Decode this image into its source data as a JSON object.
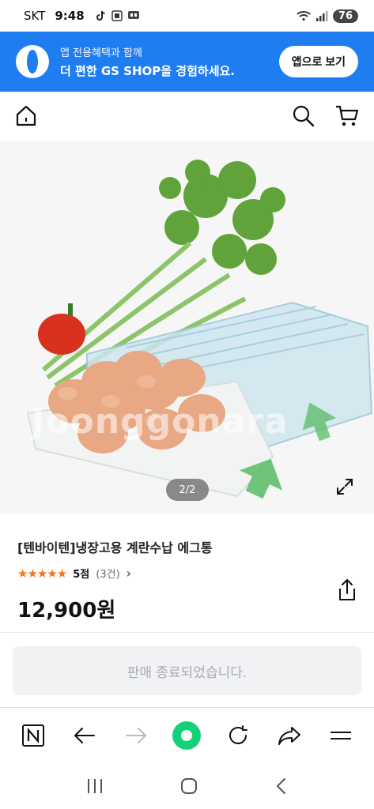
{
  "status": {
    "carrier": "SKT",
    "time": "9:48",
    "battery": "76"
  },
  "banner": {
    "line1": "앱 전용혜택과 함께",
    "line2": "더 편한 GS SHOP을 경험하세요.",
    "app_button": "앱으로 보기",
    "color": "#1f7df2"
  },
  "image": {
    "watermark": "Joonggonara",
    "page_indicator": "2/2"
  },
  "product": {
    "title": "[텐바이텐]냉장고용 계란수납 에그통",
    "stars": "★★★★★",
    "rating": "5점",
    "review_count": "(3건)",
    "review_chevron": "›",
    "price": "12,900원",
    "sold_out": "판매 종료되었습니다.",
    "star_color": "#f5731e"
  },
  "icons": [
    "home-icon",
    "search-icon",
    "cart-icon",
    "expand-icon",
    "share-icon",
    "naver-icon",
    "back-icon",
    "forward-icon",
    "record-icon",
    "refresh-icon",
    "share-arrow-icon",
    "menu-icon",
    "recents-icon",
    "home-button-icon",
    "back-nav-icon"
  ]
}
